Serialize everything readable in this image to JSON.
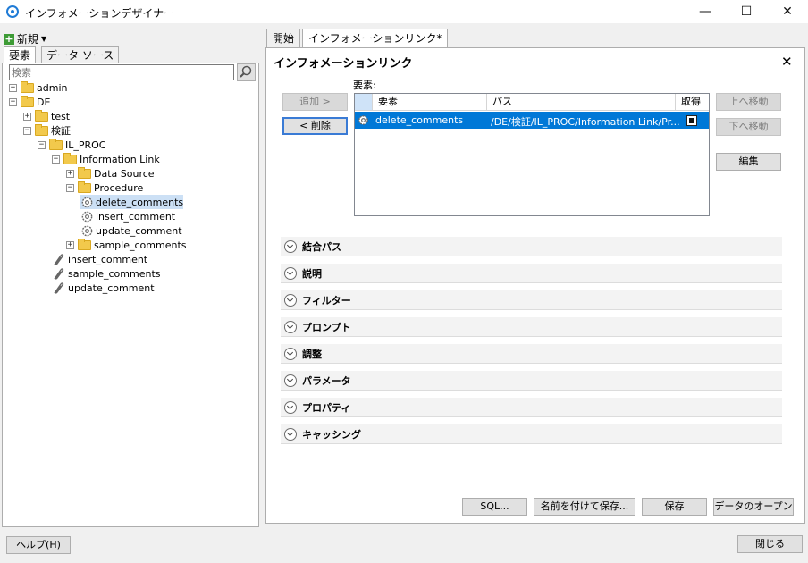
{
  "window": {
    "title": "インフォメーションデザイナー",
    "minimize": "—",
    "maximize": "☐",
    "close": "✕"
  },
  "left": {
    "new_label": "新規",
    "tabs": [
      "要素",
      "データ ソース"
    ],
    "search_placeholder": "検索",
    "tree": [
      {
        "label": "admin",
        "type": "folder",
        "exp": "+"
      },
      {
        "label": "DE",
        "type": "folder",
        "exp": "−"
      },
      {
        "label": "test",
        "type": "folder",
        "exp": "+"
      },
      {
        "label": "検証",
        "type": "folder",
        "exp": "−"
      },
      {
        "label": "IL_PROC",
        "type": "folder",
        "exp": "−"
      },
      {
        "label": "Information Link",
        "type": "folder",
        "exp": "−"
      },
      {
        "label": "Data Source",
        "type": "folder",
        "exp": "+"
      },
      {
        "label": "Procedure",
        "type": "folder",
        "exp": "−"
      },
      {
        "label": "delete_comments",
        "type": "gear",
        "exp": ""
      },
      {
        "label": "insert_comment",
        "type": "gear",
        "exp": ""
      },
      {
        "label": "update_comment",
        "type": "gear",
        "exp": ""
      },
      {
        "label": "sample_comments",
        "type": "folder",
        "exp": "+"
      },
      {
        "label": "insert_comment",
        "type": "clip",
        "exp": ""
      },
      {
        "label": "sample_comments",
        "type": "clip",
        "exp": ""
      },
      {
        "label": "update_comment",
        "type": "clip",
        "exp": ""
      }
    ],
    "help_label": "ヘルプ(H)"
  },
  "right": {
    "tabs": [
      "開始",
      "インフォメーションリンク*"
    ],
    "heading": "インフォメーションリンク",
    "close_label": "✕",
    "elements_label": "要素:",
    "add_label": "追加 >",
    "remove_label": "< 削除",
    "up_label": "上へ移動",
    "down_label": "下へ移動",
    "edit_label": "編集",
    "grid": {
      "headers": [
        "要素",
        "パス",
        "取得"
      ],
      "rows": [
        {
          "element": "delete_comments",
          "path": "/DE/検証/IL_PROC/Information Link/Pr...",
          "fetch": true
        }
      ]
    },
    "sections": [
      "結合パス",
      "説明",
      "フィルター",
      "プロンプト",
      "調整",
      "パラメータ",
      "プロパティ",
      "キャッシング"
    ],
    "sql_label": "SQL...",
    "save_as_label": "名前を付けて保存...",
    "save_label": "保存",
    "open_data_label": "データのオープン",
    "close_button_label": "閉じる"
  }
}
